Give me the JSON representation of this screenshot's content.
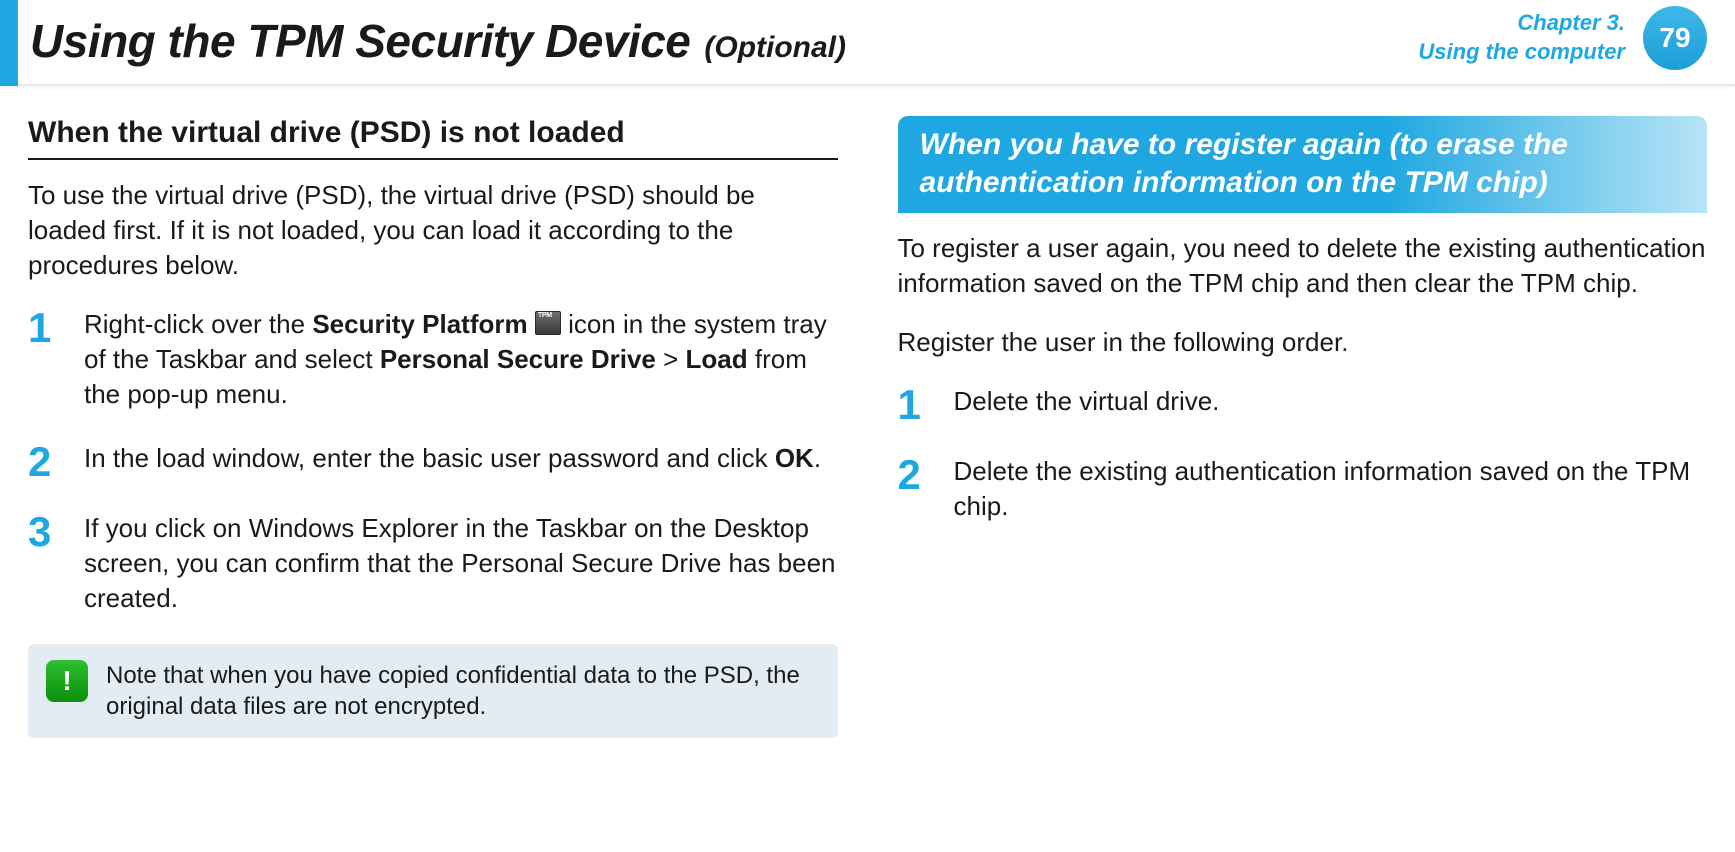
{
  "header": {
    "title": "Using the TPM Security Device",
    "optional": "(Optional)",
    "chapter_line1": "Chapter 3.",
    "chapter_line2": "Using the computer",
    "page_number": "79"
  },
  "left": {
    "heading": "When the virtual drive (PSD) is not loaded",
    "intro": "To use the virtual drive (PSD), the virtual drive (PSD) should be loaded first. If it is not loaded, you can load it according to the procedures below.",
    "step1": {
      "num": "1",
      "pre": "Right-click over the ",
      "bold1": "Security Platform",
      "mid": " icon in the system tray of the Taskbar and select ",
      "bold2": "Personal Secure Drive",
      "gt": " > ",
      "bold3": "Load",
      "post": " from the pop-up menu."
    },
    "step2": {
      "num": "2",
      "pre": "In the load window, enter the basic user password and click ",
      "bold1": "OK",
      "post": "."
    },
    "step3": {
      "num": "3",
      "text": "If you click on Windows Explorer in the Taskbar on the Desktop screen, you can confirm that the Personal Secure Drive has been created."
    },
    "alert": {
      "glyph": "!",
      "text": "Note that when you have copied confidential data to the PSD, the original data files are not encrypted."
    }
  },
  "right": {
    "heading": "When you have to register again (to erase the authentication information on the TPM chip)",
    "para1": "To register a user again, you need to delete the existing authentication information saved on the TPM chip and then clear the TPM chip.",
    "para2": "Register the user in the following order.",
    "step1": {
      "num": "1",
      "text": "Delete the virtual drive."
    },
    "step2": {
      "num": "2",
      "text": "Delete the existing authentication information saved on the TPM chip."
    }
  }
}
